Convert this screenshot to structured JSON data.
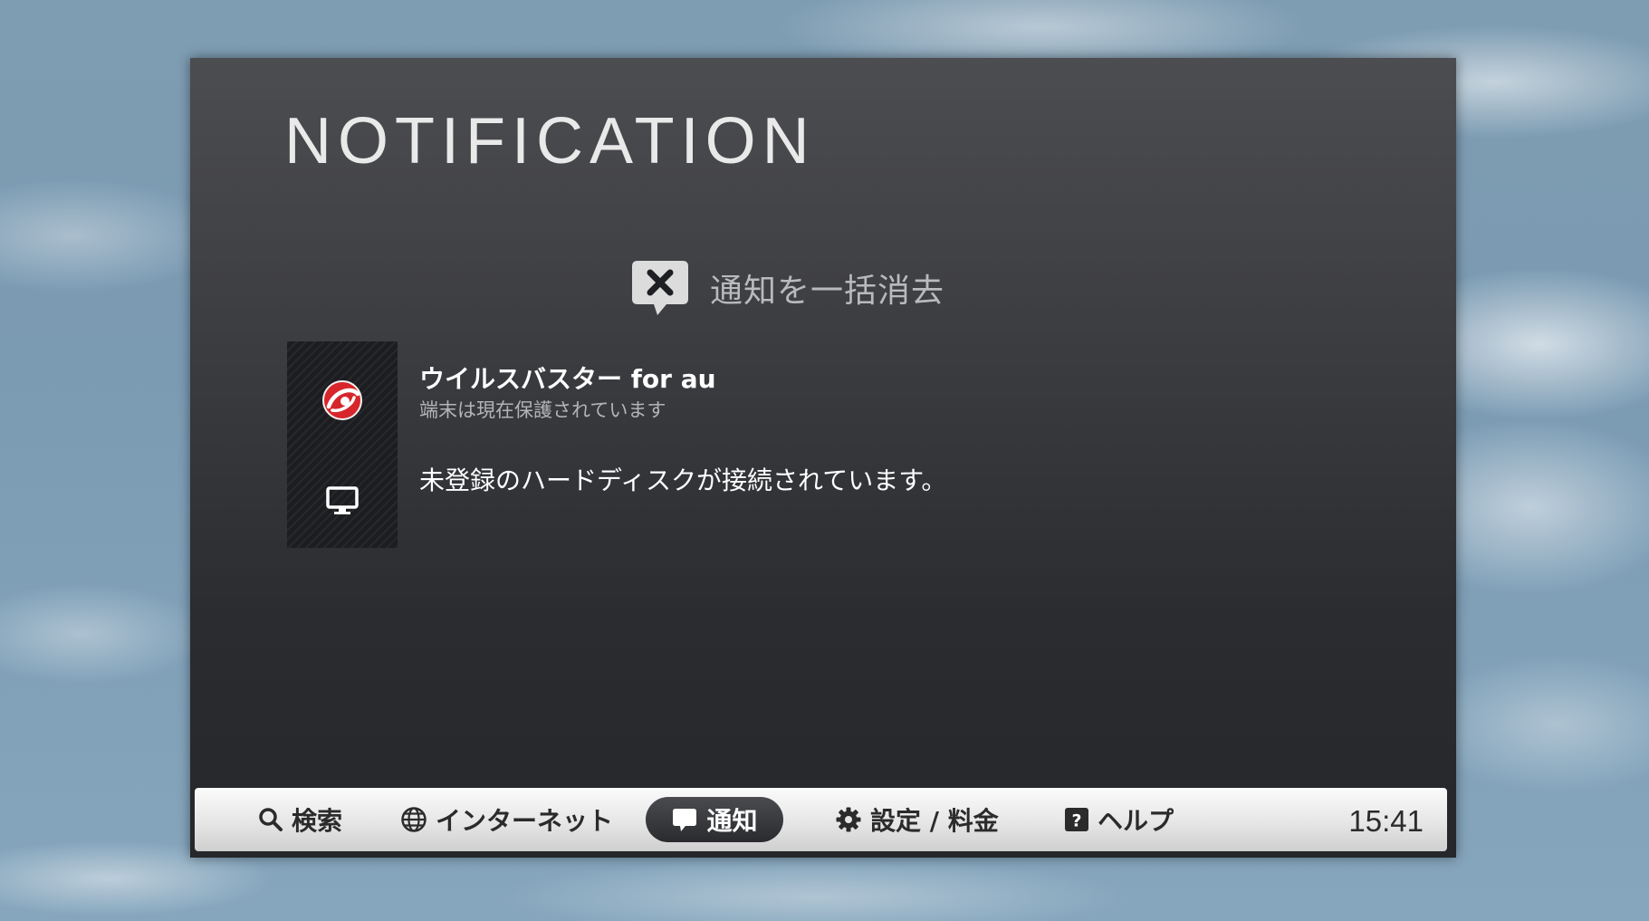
{
  "screen": {
    "title": "NOTIFICATION"
  },
  "actions": {
    "clear_all_label": "通知を一括消去"
  },
  "notifications": [
    {
      "title": "ウイルスバスター for au",
      "subtitle": "端末は現在保護されています",
      "icon": "virus-buster-logo"
    },
    {
      "title": "未登録のハードディスクが接続されています。",
      "icon": "monitor-icon"
    }
  ],
  "nav": {
    "items": [
      {
        "label": "検索",
        "icon": "search-icon"
      },
      {
        "label": "インターネット",
        "icon": "globe-icon"
      },
      {
        "label": "通知",
        "icon": "speech-bubble-icon",
        "selected": true
      },
      {
        "label": "設定 / 料金",
        "icon": "gear-icon"
      },
      {
        "label": "ヘルプ",
        "icon": "help-icon"
      }
    ],
    "clock": "15:41"
  },
  "colors": {
    "panel": "#3a3b3f",
    "bar": "#e6e6e6",
    "selected_tab": "#2f3033",
    "logo_red": "#d7262b"
  }
}
